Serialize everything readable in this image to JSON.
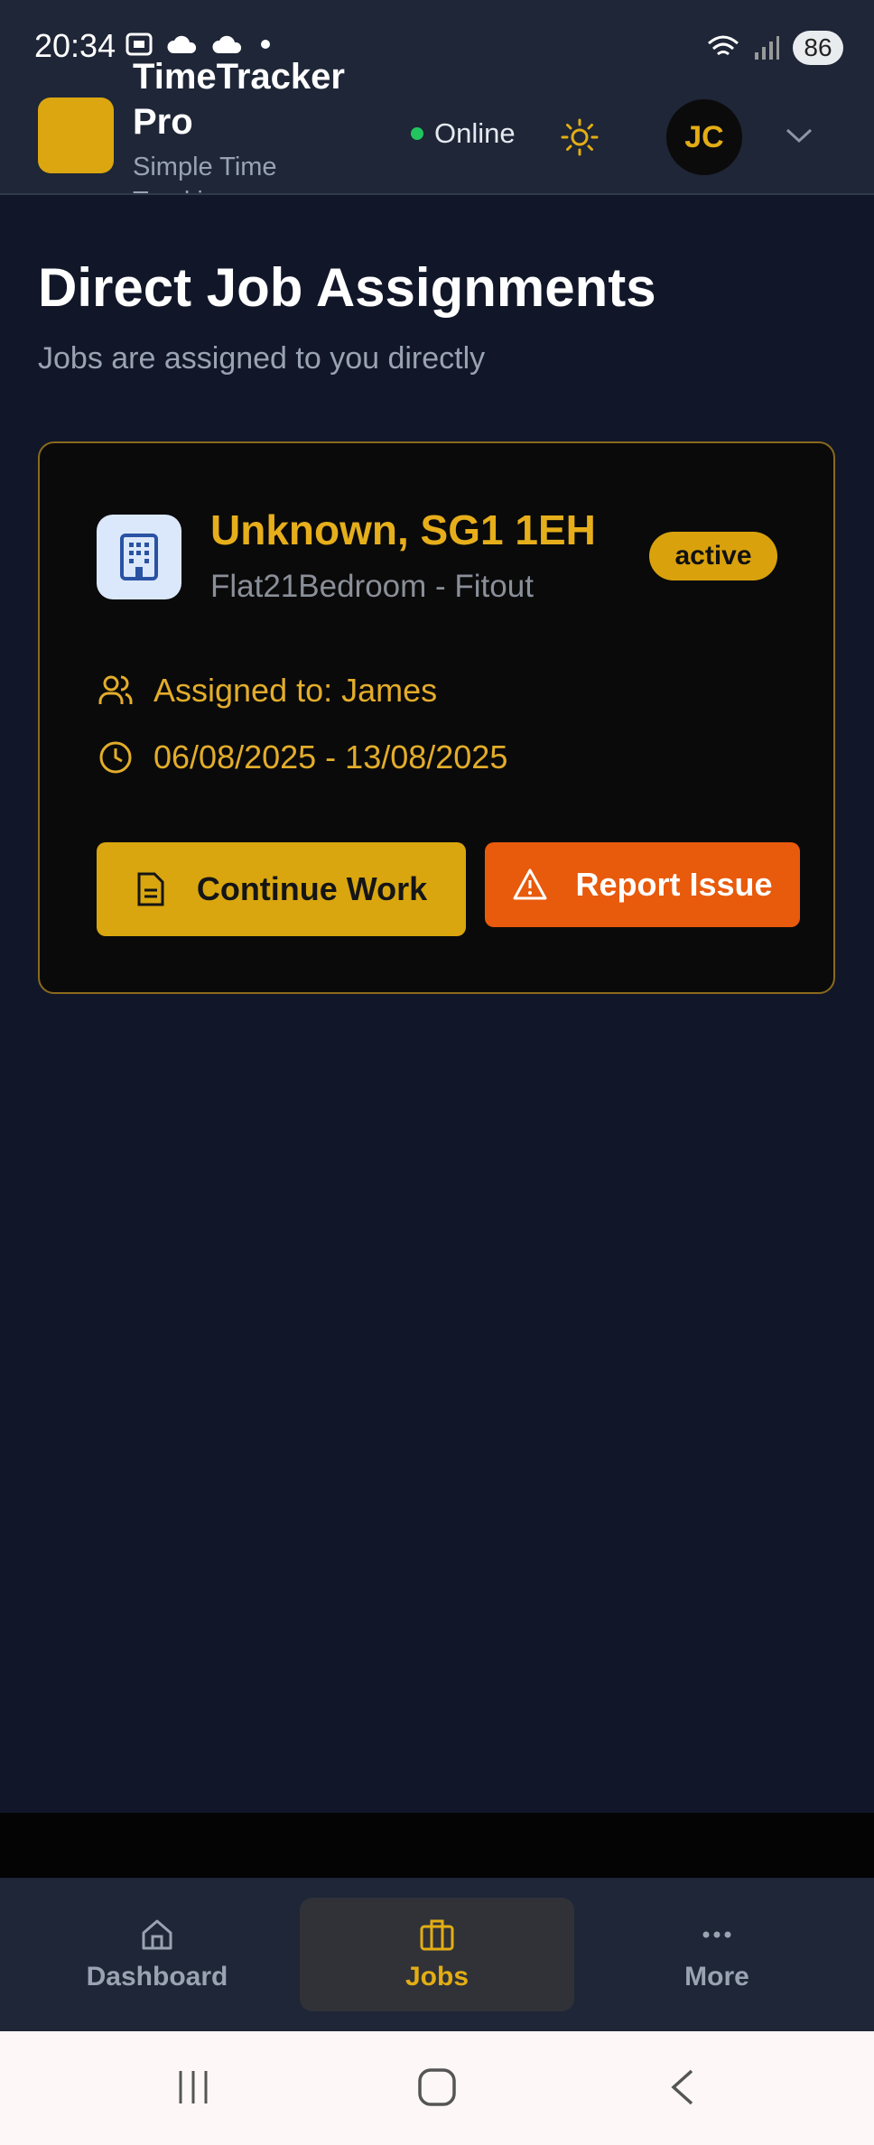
{
  "status_bar": {
    "time": "20:34",
    "battery": "86"
  },
  "header": {
    "app_name": "TimeTracker Pro",
    "app_subtitle": "Simple Time Tracking",
    "connection_status": "Online",
    "user_initials": "JC"
  },
  "page": {
    "title": "Direct Job Assignments",
    "subtitle": "Jobs are assigned to you directly"
  },
  "job_card": {
    "title": "Unknown, SG1 1EH",
    "subtitle": "Flat21Bedroom - Fitout",
    "status": "active",
    "assigned_to": "Assigned to: James",
    "date_range": "06/08/2025 - 13/08/2025",
    "continue_label": "Continue Work",
    "report_label": "Report Issue"
  },
  "bottom_nav": {
    "items": [
      {
        "label": "Dashboard",
        "icon": "home-icon"
      },
      {
        "label": "Jobs",
        "icon": "briefcase-icon",
        "active": true
      },
      {
        "label": "More",
        "icon": "more-dots-icon"
      }
    ]
  },
  "colors": {
    "accent": "#dba60f",
    "background": "#111729",
    "header": "#1e2637",
    "danger": "#e85a0c",
    "online": "#22c55e"
  }
}
